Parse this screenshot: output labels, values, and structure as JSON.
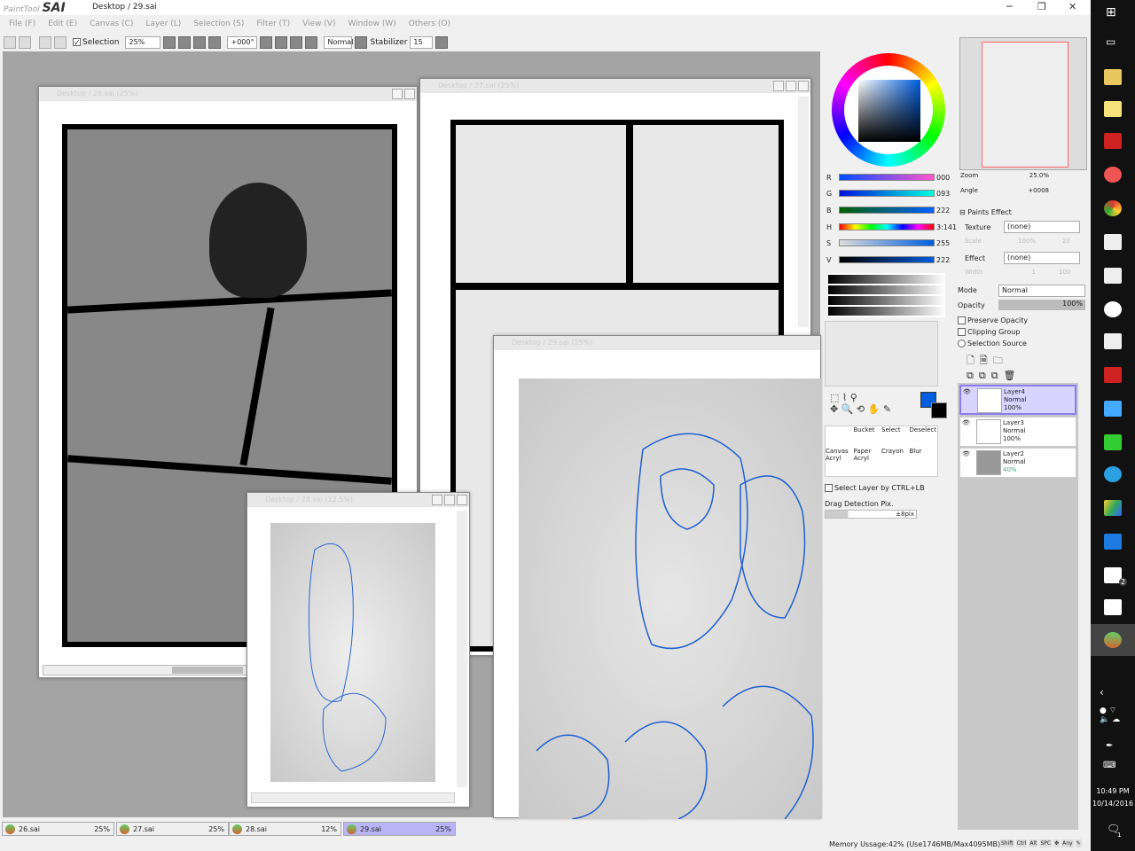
{
  "app": {
    "logo_text": "PaintTool SAI",
    "title": "Desktop / 29.sai"
  },
  "menu": [
    "File (F)",
    "Edit (E)",
    "Canvas (C)",
    "Layer (L)",
    "Selection (S)",
    "Filter (T)",
    "View (V)",
    "Window (W)",
    "Others (O)"
  ],
  "toolbar": {
    "selection_label": "Selection",
    "selection_checked": true,
    "zoom": "25%",
    "angle": "+000°",
    "blend": "Normal",
    "stabilizer_label": "Stabilizer",
    "stabilizer": "15"
  },
  "windows": [
    {
      "title": "Desktop / 26.sai (25%)"
    },
    {
      "title": "Desktop / 27.sai (25%)"
    },
    {
      "title": "Desktop / 28.sai (12.5%)"
    },
    {
      "title": "Desktop / 29.sai (25%)"
    }
  ],
  "color": {
    "R": "000",
    "G": "093",
    "B": "222",
    "H": "3:141",
    "S": "255",
    "V": "222",
    "fg": "#005dde",
    "bg": "#000000"
  },
  "tools": {
    "brushes": [
      "Bucket",
      "Select",
      "Deselect",
      "Canvas Acryl",
      "Paper Acryl",
      "Crayon",
      "Blur"
    ],
    "select_layer_label": "Select Layer by CTRL+LB",
    "drag_label": "Drag Detection Pix.",
    "drag_value": "±8pix"
  },
  "navigator": {
    "zoom_label": "Zoom",
    "zoom": "25.0%",
    "angle_label": "Angle",
    "angle": "+0008"
  },
  "paints_effect": {
    "header": "Paints Effect",
    "texture_label": "Texture",
    "texture": "(none)",
    "scale_label": "Scale",
    "scale": "100%",
    "scale2": "20",
    "effect_label": "Effect",
    "effect": "(none)",
    "width_label": "Width",
    "width": "1",
    "width2": "100"
  },
  "layer_props": {
    "mode_label": "Mode",
    "mode": "Normal",
    "opacity_label": "Opacity",
    "opacity": "100%",
    "preserve": "Preserve Opacity",
    "clipping": "Clipping Group",
    "selsource": "Selection Source"
  },
  "layers": [
    {
      "name": "Layer4",
      "mode": "Normal",
      "opacity": "100%"
    },
    {
      "name": "Layer3",
      "mode": "Normal",
      "opacity": "100%"
    },
    {
      "name": "Layer2",
      "mode": "Normal",
      "opacity": "40%"
    }
  ],
  "doc_tabs": [
    {
      "name": "26.sai",
      "zoom": "25%"
    },
    {
      "name": "27.sai",
      "zoom": "25%"
    },
    {
      "name": "28.sai",
      "zoom": "12%"
    },
    {
      "name": "29.sai",
      "zoom": "25%"
    }
  ],
  "status": {
    "memory": "Memory Ussage:42% (Use1746MB/Max4095MB)",
    "keys": [
      "Shift",
      "Ctrl",
      "Alt",
      "SPC",
      "Any"
    ]
  },
  "taskbar": {
    "time": "10:49 PM",
    "date": "10/14/2016",
    "mail_badge": "2",
    "notif_badge": "1"
  }
}
